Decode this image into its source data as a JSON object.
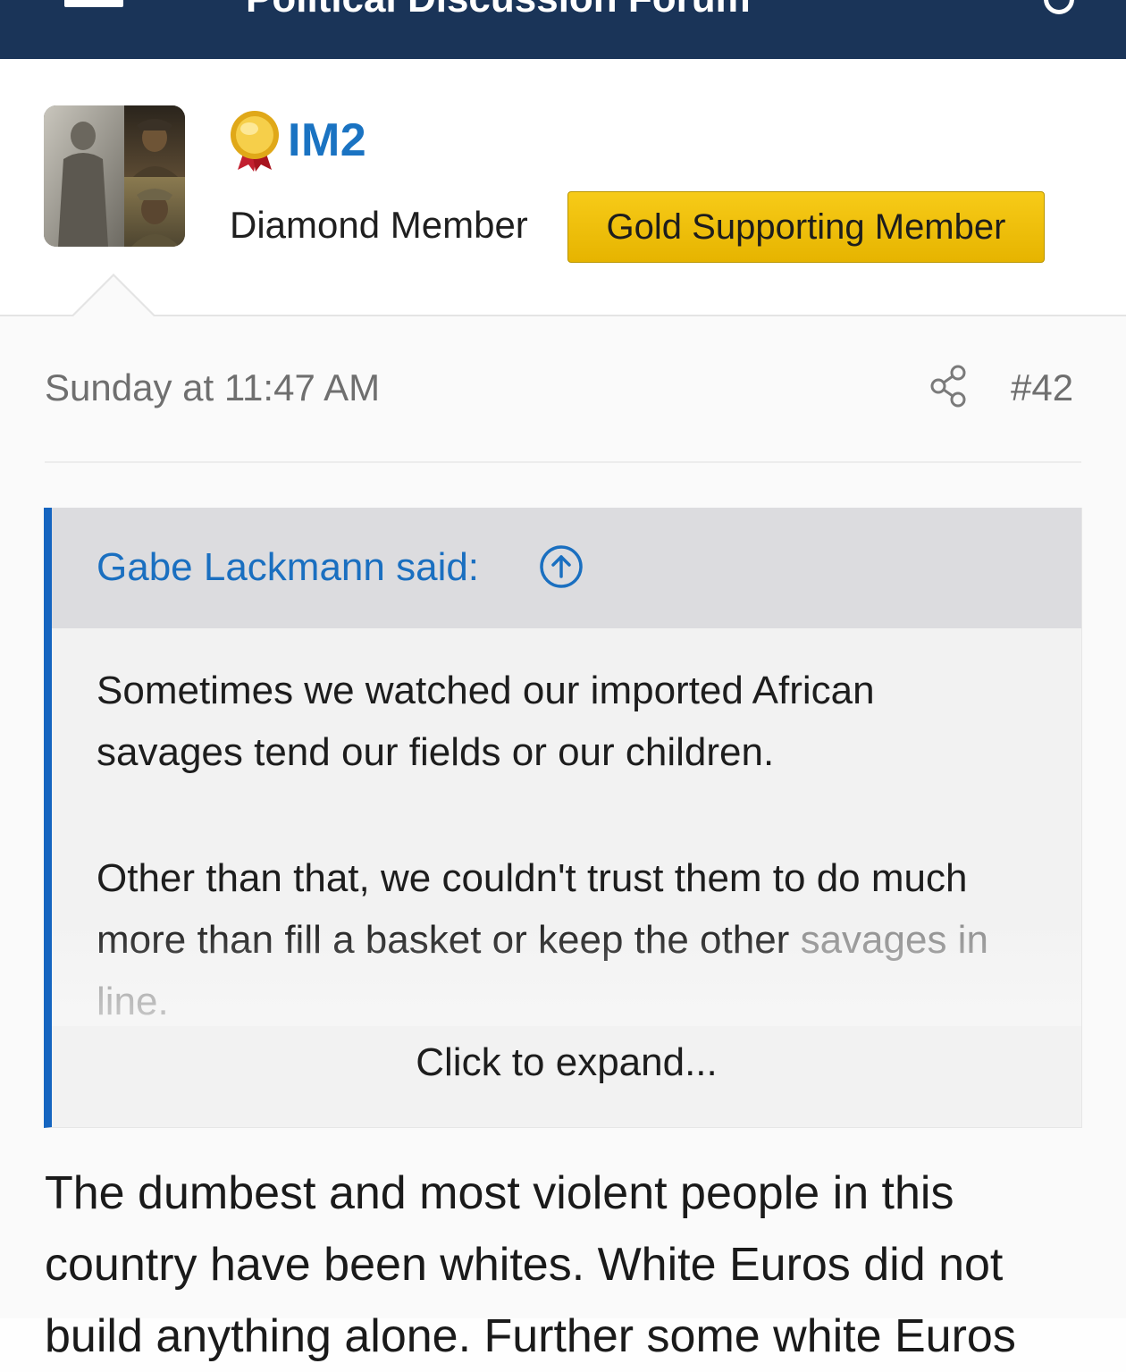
{
  "topbar": {
    "title": "Political Discussion Forum"
  },
  "user": {
    "avatar_icon": "avatar-image",
    "medal_icon": "gold-medal-icon",
    "name": "IM2",
    "title": "Diamond Member",
    "badge": "Gold Supporting Member"
  },
  "post": {
    "date": "Sunday at 11:47 AM",
    "share_icon": "share-icon",
    "number": "#42",
    "quote": {
      "author": "Gabe Lackmann said:",
      "jump_icon": "arrow-up-circle-icon",
      "paragraph1": "Sometimes we watched our imported African savages tend our fields or our children.",
      "paragraph2_start": "Other than that, we couldn't trust them to do much more than fill a basket or keep the other",
      "paragraph2_end": "savages in line.",
      "expand": "Click to expand..."
    },
    "body": "The dumbest and most violent people in this country have been whites. White Euros did not build anything alone. Further some white Euros"
  },
  "colors": {
    "topbar": "#1a3458",
    "link": "#1a73c2",
    "badge": "#f0c30f",
    "quote_border": "#1565c0"
  }
}
